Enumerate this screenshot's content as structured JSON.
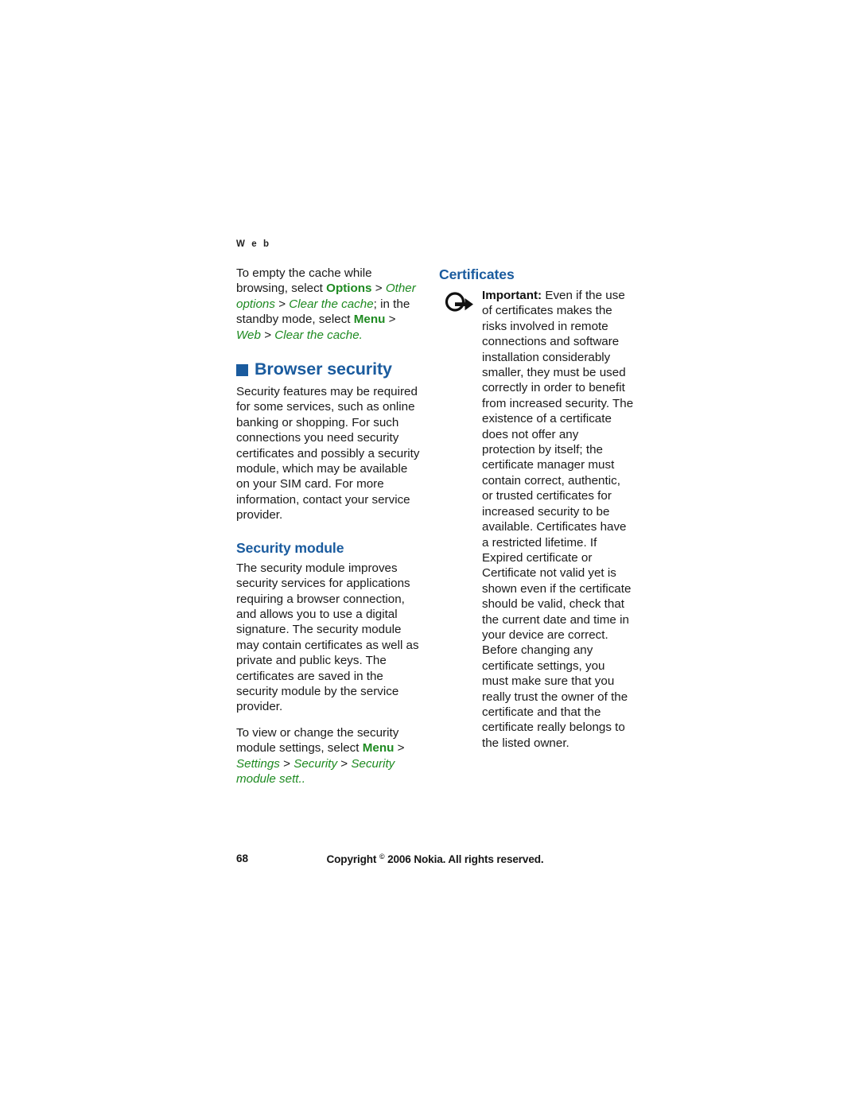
{
  "document": {
    "running_head": "W e b",
    "page_number": "68",
    "copyright_prefix": "Copyright",
    "copyright_symbol": "©",
    "copyright_rest": "2006 Nokia. All rights reserved."
  },
  "colors": {
    "heading_blue": "#1a5b9e",
    "menu_green": "#1e8a21",
    "body_text": "#1a1a1a"
  },
  "left_column": {
    "cache_paragraph": {
      "part1": "To empty the cache while browsing, select ",
      "menu1": "Options",
      "sep1": " > ",
      "menu2": "Other options",
      "sep2": " > ",
      "menu3": "Clear the cache",
      "part2": "; in the standby mode, select ",
      "menu4": "Menu",
      "sep3": " > ",
      "menu5": "Web",
      "sep4": " > ",
      "menu6": "Clear the cache."
    },
    "browser_security_heading": "Browser security",
    "browser_security_body": "Security features may be required for some services, such as online banking or shopping. For such connections you need security certificates and possibly a security module, which may be available on your SIM card. For more information, contact your service provider.",
    "security_module_heading": "Security module",
    "security_module_body": "The security module improves security services for applications requiring a browser connection, and allows you to use a digital signature. The security module may contain certificates as well as private and public keys. The certificates are saved in the security module by the service provider.",
    "settings_paragraph": {
      "part1": "To view or change the security module settings, select ",
      "menu1": "Menu",
      "sep1": " > ",
      "menu2": "Settings",
      "sep2": " > ",
      "menu3": "Security",
      "sep3": " > ",
      "menu4": "Security module sett.."
    }
  },
  "right_column": {
    "certificates_heading": "Certificates",
    "note_icon_name": "important-note-icon",
    "note_label": "Important:",
    "note_body": " Even if the use of certificates makes the risks involved in remote connections and software installation considerably smaller, they must be used correctly in order to benefit from increased security. The existence of a certificate does not offer any protection by itself; the certificate manager must contain correct, authentic, or trusted certificates for increased security to be available. Certificates have a restricted lifetime. If Expired certificate or Certificate not valid yet is shown even if the certificate should be valid, check that the current date and time in your device are correct. Before changing any certificate settings, you must make sure that you really trust the owner of the certificate and that the certificate really belongs to the listed owner."
  }
}
